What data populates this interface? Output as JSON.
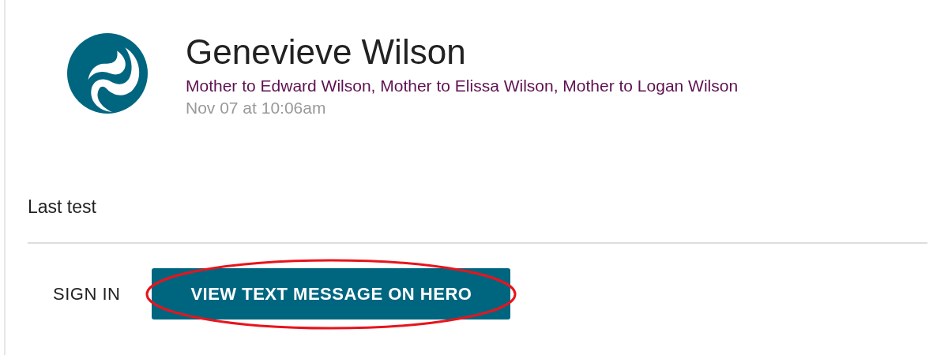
{
  "contact": {
    "name": "Genevieve Wilson",
    "relations": "Mother to Edward Wilson, Mother to Elissa Wilson, Mother to Logan Wilson",
    "timestamp": "Nov 07 at 10:06am"
  },
  "message": {
    "text": "Last test"
  },
  "actions": [
    {
      "label": "SIGN IN",
      "kind": "text",
      "highlighted": false
    },
    {
      "label": "VIEW TEXT MESSAGE ON HERO",
      "kind": "primary",
      "highlighted": true
    }
  ]
}
